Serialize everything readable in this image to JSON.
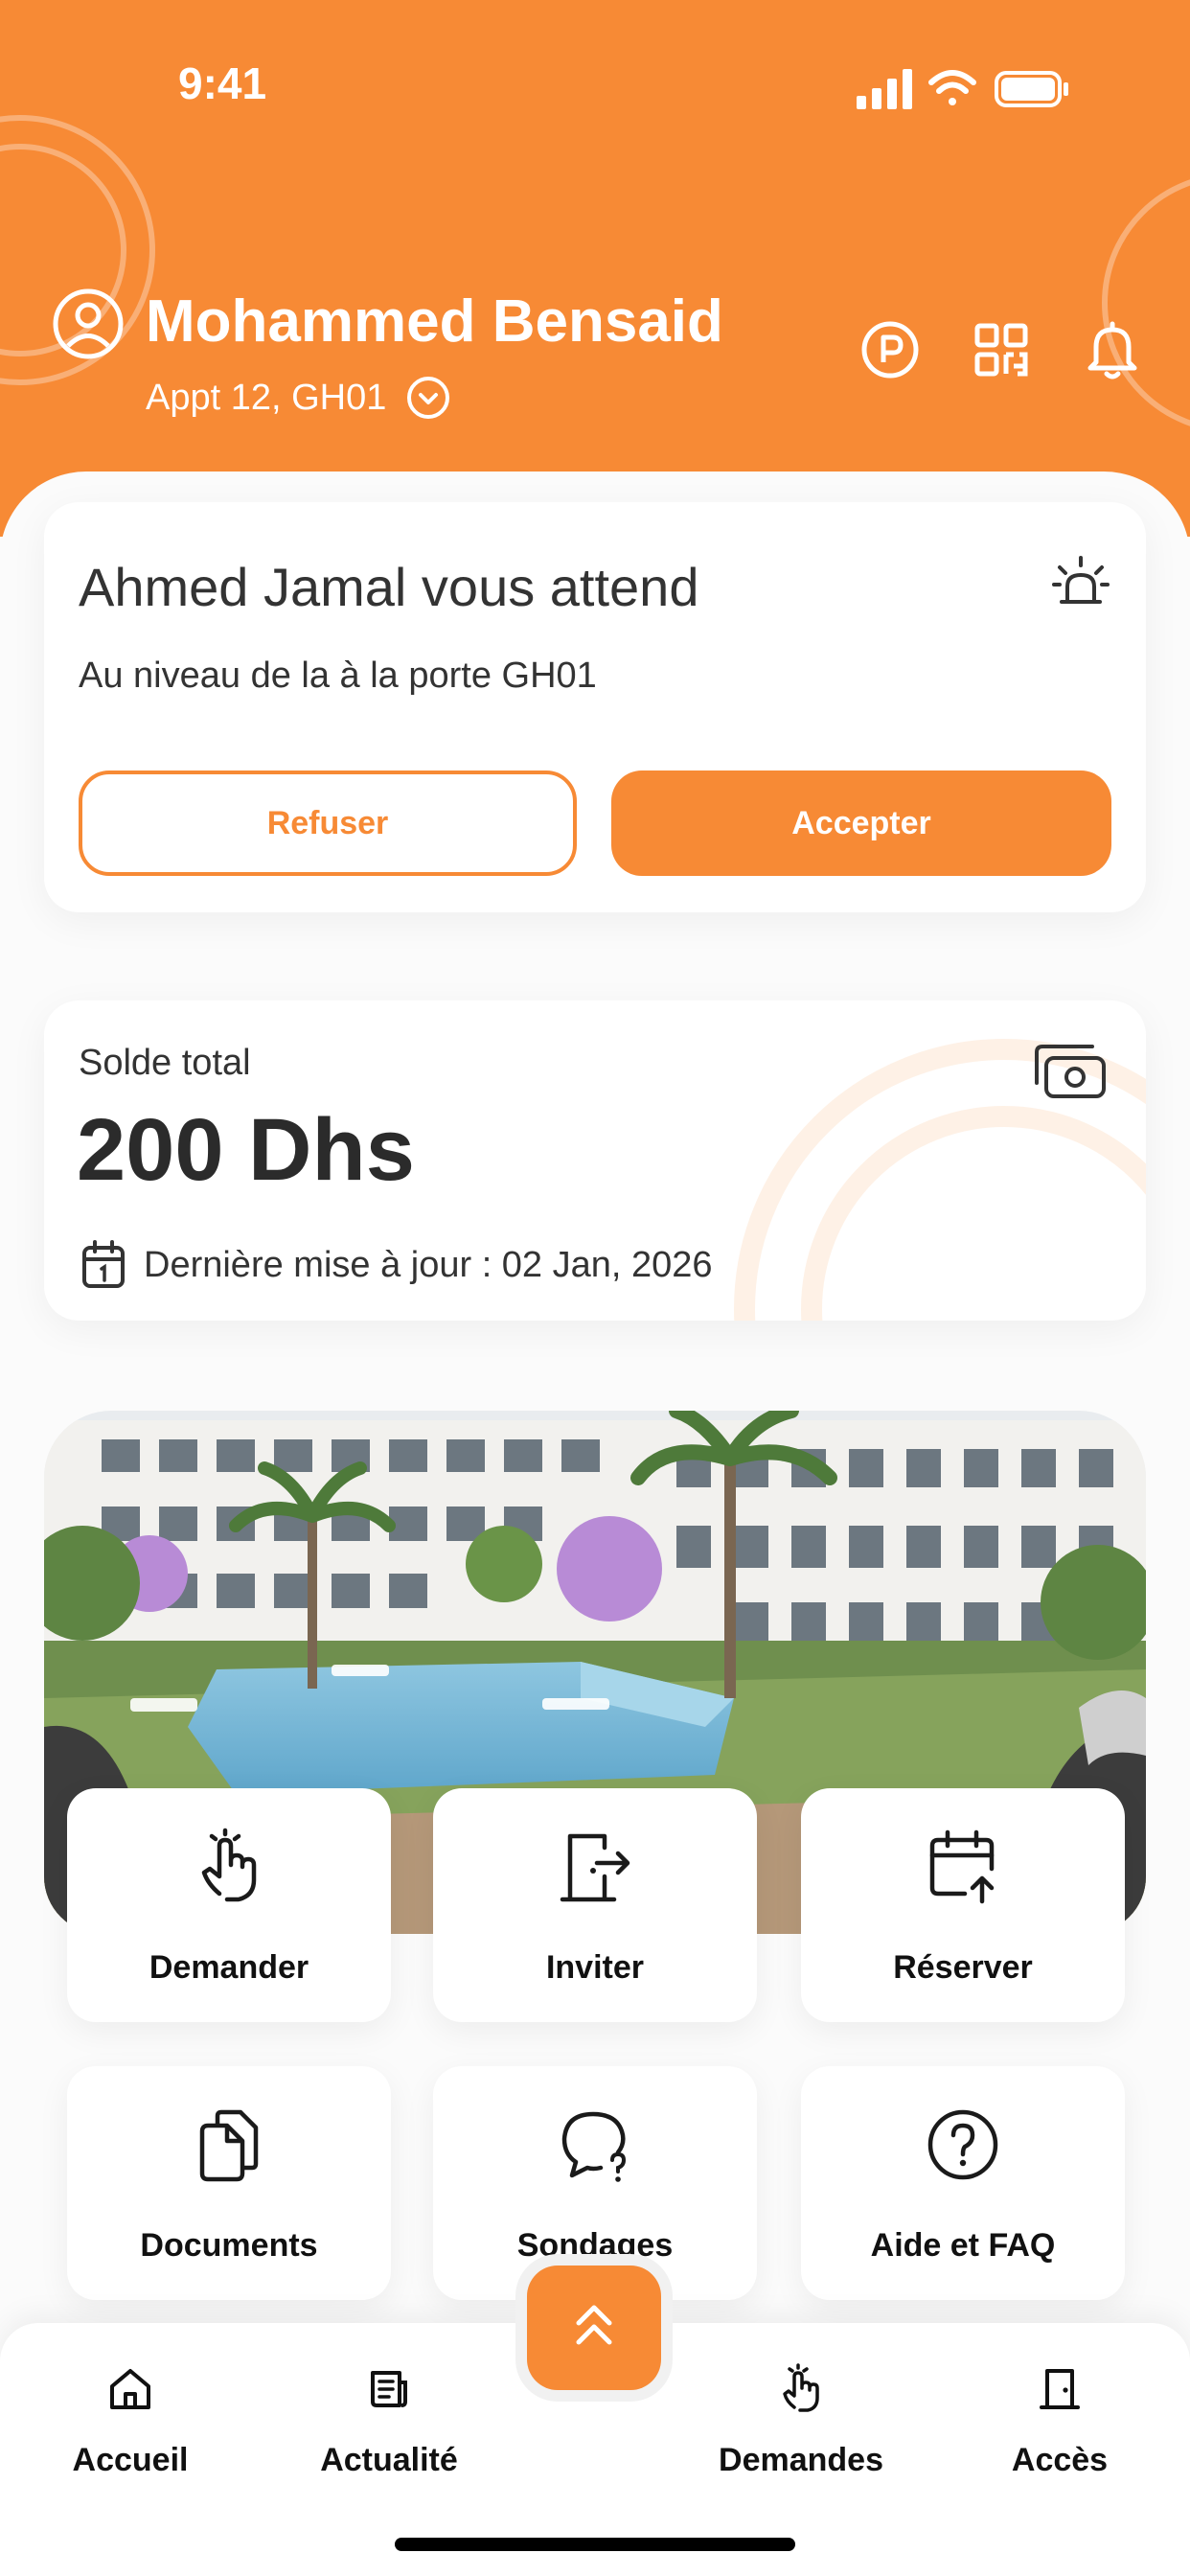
{
  "status_bar": {
    "time": "9:41"
  },
  "header": {
    "user_name": "Mohammed Bensaid",
    "apartment": "Appt 12, GH01"
  },
  "visitor_card": {
    "title": "Ahmed Jamal vous attend",
    "subtitle": "Au niveau de la  à la porte GH01",
    "refuse_label": "Refuser",
    "accept_label": "Accepter"
  },
  "balance_card": {
    "label": "Solde total",
    "value": "200 Dhs",
    "last_update": "Dernière mise à jour : 02 Jan, 2026"
  },
  "actions": [
    {
      "label": "Demander",
      "icon": "hand-pointer-icon"
    },
    {
      "label": "Inviter",
      "icon": "door-arrow-icon"
    },
    {
      "label": "Réserver",
      "icon": "calendar-upload-icon"
    },
    {
      "label": "Documents",
      "icon": "documents-icon"
    },
    {
      "label": "Sondages",
      "icon": "chat-question-icon"
    },
    {
      "label": "Aide et FAQ",
      "icon": "help-circle-icon"
    }
  ],
  "bottom_nav": {
    "items": [
      {
        "label": "Accueil",
        "icon": "home-icon"
      },
      {
        "label": "Actualité",
        "icon": "news-icon"
      },
      {
        "label": "Demandes",
        "icon": "hand-pointer-icon"
      },
      {
        "label": "Accès",
        "icon": "door-icon"
      }
    ],
    "fab_icon": "chevrons-up-icon"
  },
  "colors": {
    "brand": "#F78A35",
    "background": "#FBFBFB",
    "text": "#222222"
  }
}
